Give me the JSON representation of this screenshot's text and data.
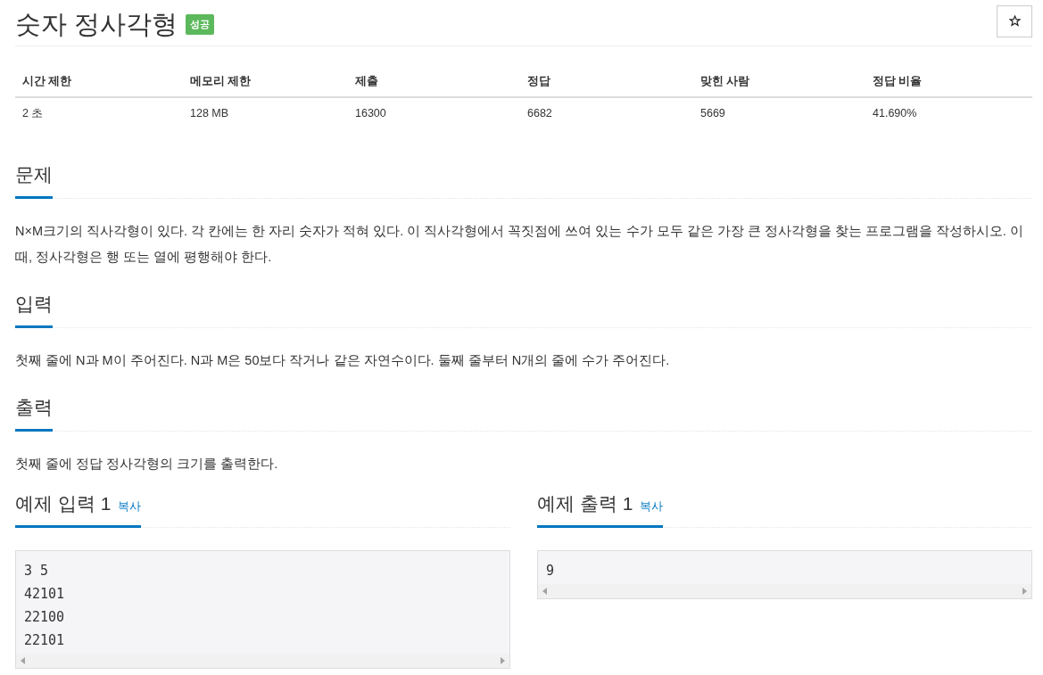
{
  "title": "숫자 정사각형",
  "status_badge": "성공",
  "stats_table": {
    "columns": [
      "시간 제한",
      "메모리 제한",
      "제출",
      "정답",
      "맞힌 사람",
      "정답 비율"
    ],
    "rows": [
      [
        "2 초",
        "128 MB",
        "16300",
        "6682",
        "5669",
        "41.690%"
      ]
    ]
  },
  "sections": [
    {
      "heading": "문제",
      "paragraphs": [
        "N×M크기의 직사각형이 있다. 각 칸에는 한 자리 숫자가 적혀 있다. 이 직사각형에서 꼭짓점에 쓰여 있는 수가 모두 같은 가장 큰 정사각형을 찾는 프로그램을 작성하시오. 이때, 정사각형은 행 또는 열에 평행해야 한다."
      ]
    },
    {
      "heading": "입력",
      "paragraphs": [
        "첫째 줄에 N과 M이 주어진다. N과 M은 50보다 작거나 같은 자연수이다. 둘째 줄부터 N개의 줄에 수가 주어진다."
      ]
    },
    {
      "heading": "출력",
      "paragraphs": [
        "첫째 줄에 정답 정사각형의 크기를 출력한다."
      ]
    }
  ],
  "samples": [
    {
      "heading": "예제 입력 1",
      "copy_label": "복사",
      "lines": [
        "3 5",
        "42101",
        "22100",
        "22101"
      ]
    },
    {
      "heading": "예제 출력 1",
      "copy_label": "복사",
      "lines": [
        "9"
      ]
    }
  ]
}
